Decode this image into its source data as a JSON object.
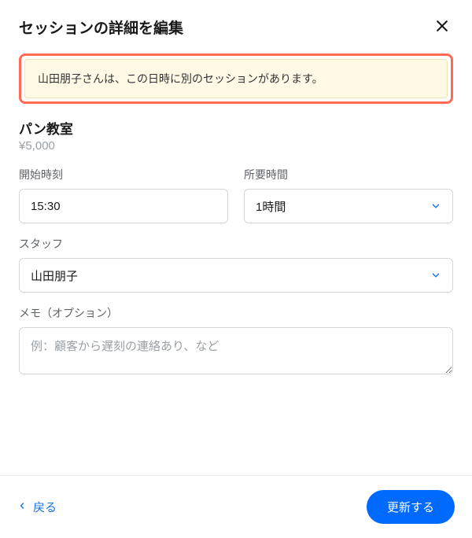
{
  "header": {
    "title": "セッションの詳細を編集"
  },
  "alert": {
    "message": "山田朋子さんは、この日時に別のセッションがあります。"
  },
  "session": {
    "name": "パン教室",
    "price": "¥5,000"
  },
  "form": {
    "start_time": {
      "label": "開始時刻",
      "value": "15:30"
    },
    "duration": {
      "label": "所要時間",
      "value": "1時間"
    },
    "staff": {
      "label": "スタッフ",
      "value": "山田朋子"
    },
    "memo": {
      "label": "メモ（オプション）",
      "placeholder": "例：顧客から遅刻の連絡あり、など"
    }
  },
  "footer": {
    "back_label": "戻る",
    "update_label": "更新する"
  }
}
